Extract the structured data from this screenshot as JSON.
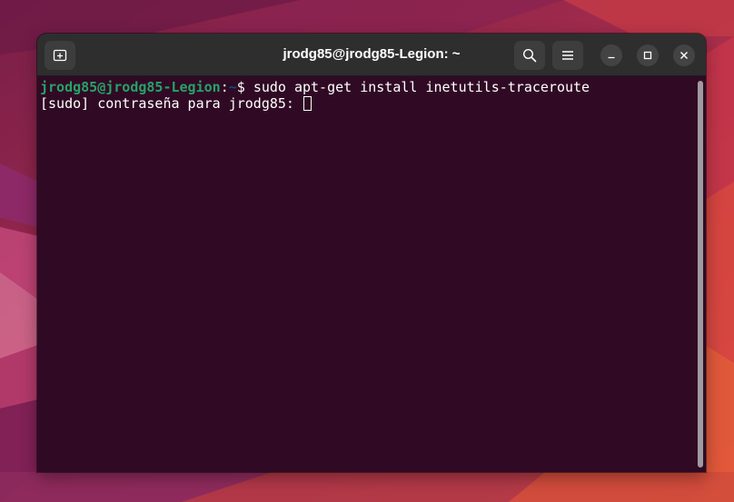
{
  "window": {
    "title": "jrodg85@jrodg85-Legion: ~"
  },
  "headerbar": {
    "new_tab_icon": "new-tab-icon",
    "search_icon": "search-icon",
    "menu_icon": "hamburger-menu-icon",
    "minimize_icon": "minimize-icon",
    "maximize_icon": "maximize-icon",
    "close_icon": "close-icon"
  },
  "terminal": {
    "prompt_user_host": "jrodg85@jrodg85-Legion",
    "prompt_colon": ":",
    "prompt_path": "~",
    "prompt_symbol": "$ ",
    "command": "sudo apt-get install inetutils-traceroute",
    "sudo_prompt": "[sudo] contraseña para jrodg85: "
  },
  "colors": {
    "terminal_background": "#300a24",
    "prompt_user": "#26a269",
    "prompt_path": "#12488b",
    "headerbar": "#2e2e2e"
  }
}
